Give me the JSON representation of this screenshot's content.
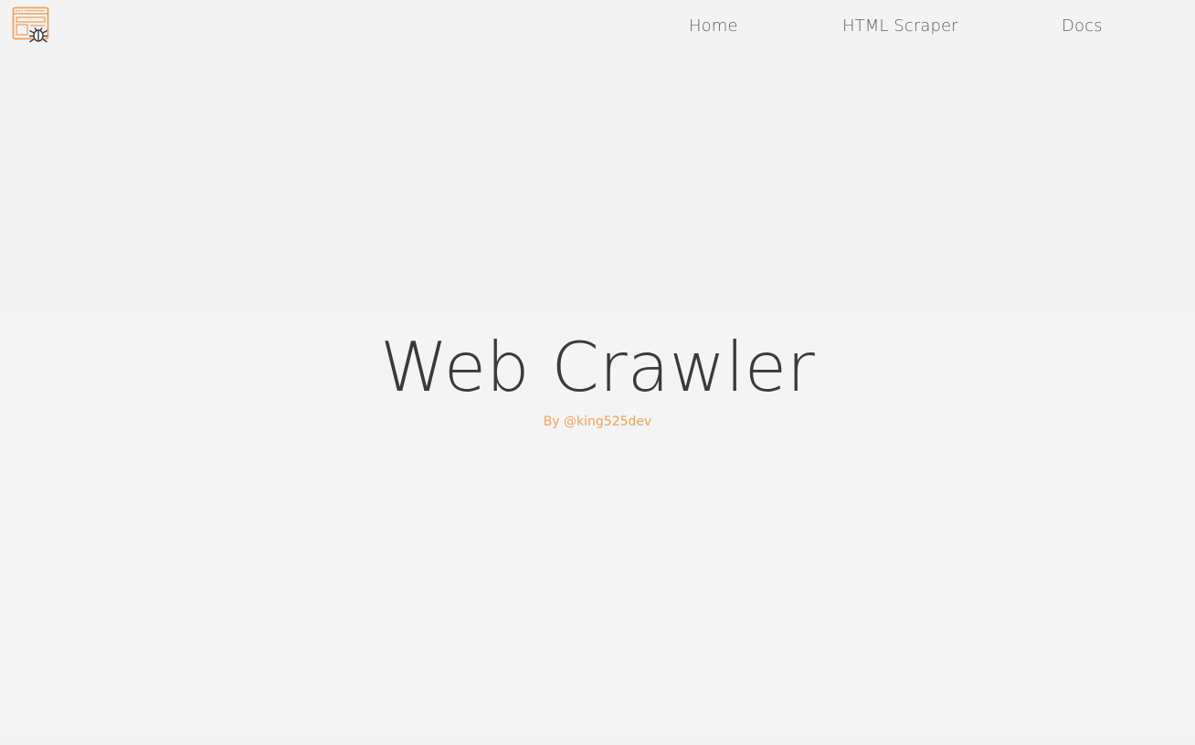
{
  "nav": {
    "logo_icon": "browser-bug-icon",
    "items": [
      {
        "label": "Home"
      },
      {
        "label": "HTML Scraper"
      },
      {
        "label": "Docs"
      }
    ]
  },
  "hero": {
    "title": "Web Crawler",
    "subtitle": "By @king525dev"
  },
  "colors": {
    "background": "#f3f3f3",
    "accent": "#eea15a",
    "title": "#3a3a3a",
    "nav_text": "#5d5d5d"
  }
}
